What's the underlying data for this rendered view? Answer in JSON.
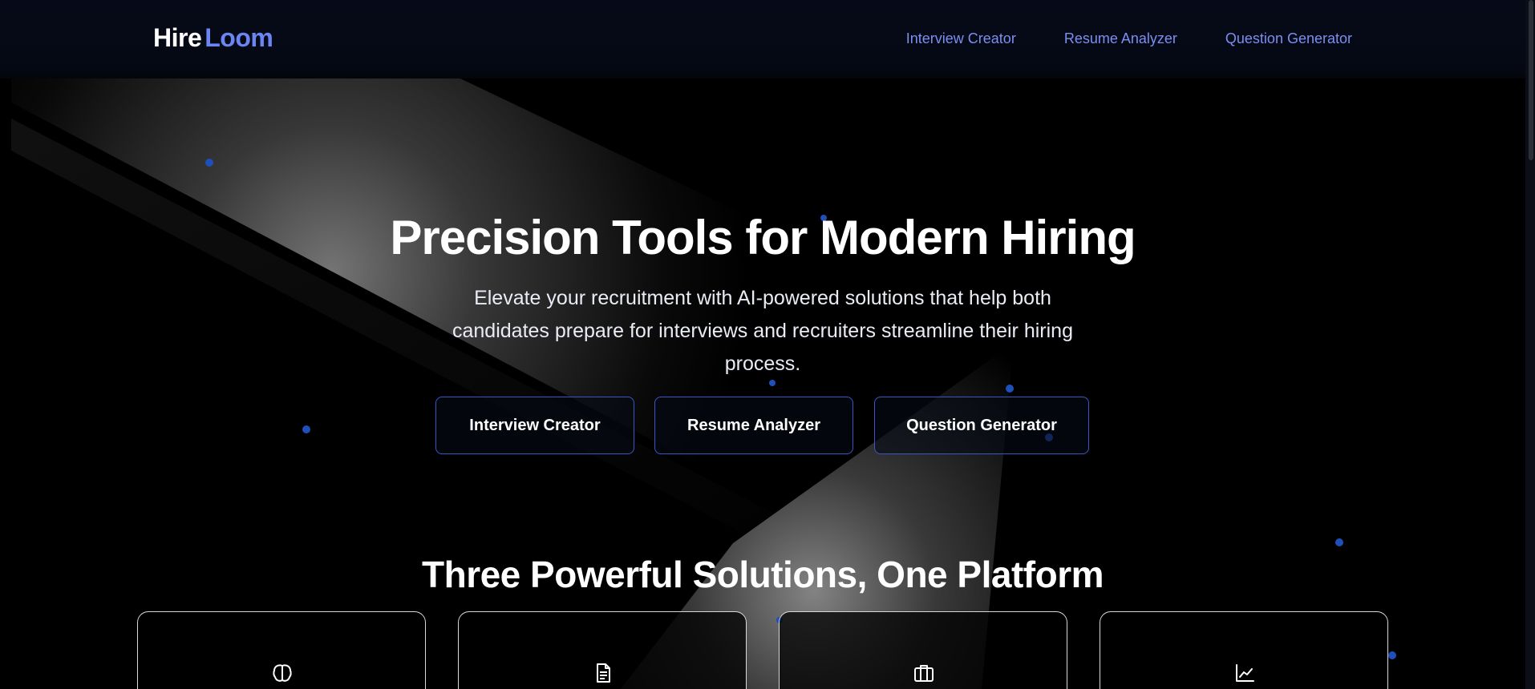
{
  "brand": {
    "part1": "Hire",
    "part2": "Loom",
    "accent": "#6b86f2"
  },
  "nav": {
    "items": [
      {
        "label": "Interview Creator"
      },
      {
        "label": "Resume Analyzer"
      },
      {
        "label": "Question Generator"
      }
    ]
  },
  "hero": {
    "title": "Precision Tools for Modern Hiring",
    "subtitle": "Elevate your recruitment with AI-powered solutions that help both candidates prepare for interviews and recruiters streamline their hiring process.",
    "buttons": [
      {
        "label": "Interview Creator"
      },
      {
        "label": "Resume Analyzer"
      },
      {
        "label": "Question Generator"
      }
    ]
  },
  "features": {
    "title": "Three Powerful Solutions, One Platform",
    "cards": [
      {
        "icon": "brain-icon"
      },
      {
        "icon": "document-icon"
      },
      {
        "icon": "briefcase-icon"
      },
      {
        "icon": "chart-line-icon"
      }
    ]
  },
  "colors": {
    "background": "#000000",
    "header": "#050914",
    "link": "#7b8ff0",
    "button_border": "#3b57c7"
  }
}
